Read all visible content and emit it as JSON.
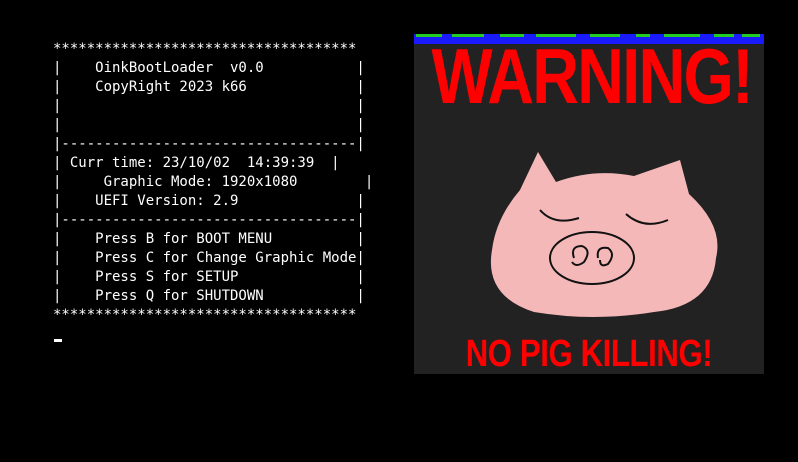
{
  "terminal": {
    "lines": [
      "************************************",
      "|    OinkBootLoader  v0.0           |",
      "|    CopyRight 2023 k66             |",
      "|                                   |",
      "|                                   |",
      "|-----------------------------------|",
      "| Curr time: 23/10/02  14:39:39  |",
      "|     Graphic Mode: 1920x1080        |",
      "|    UEFI Version: 2.9              |",
      "|-----------------------------------|",
      "|    Press B for BOOT MENU          |",
      "|    Press C for Change Graphic Mode|",
      "|    Press S for SETUP              |",
      "|    Press Q for SHUTDOWN           |",
      "************************************"
    ]
  },
  "banner": {
    "warning_text": "WARNING!",
    "footer_text": "NO PIG KILLING!",
    "background_color": "#222222",
    "text_color": "#ff0000",
    "pig_color": "#f5b8b8",
    "strip_colors": [
      "#1a1aff",
      "#22cc22"
    ]
  },
  "colors": {
    "screen_background": "#000000",
    "terminal_text": "#ffffff"
  },
  "icons": {
    "pig": "pig-face-drawing",
    "cursor": "text-cursor"
  }
}
